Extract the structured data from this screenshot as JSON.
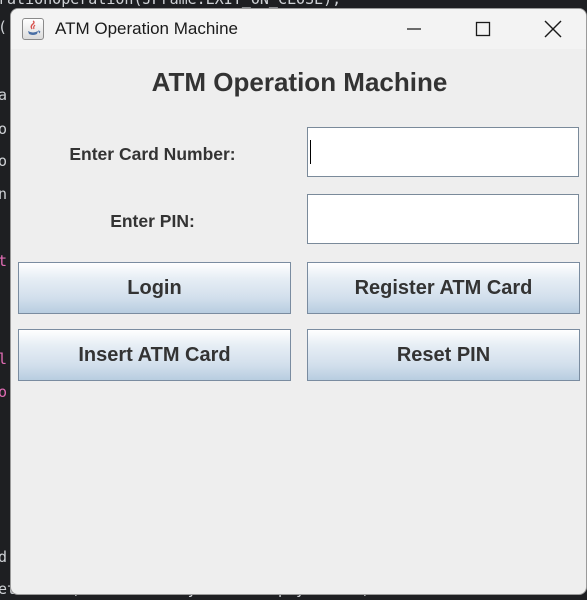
{
  "window": {
    "title": "ATM Operation Machine"
  },
  "form": {
    "heading": "ATM Operation Machine",
    "card_label": "Enter Card Number:",
    "card_value": "",
    "pin_label": "Enter PIN:",
    "pin_value": ""
  },
  "buttons": {
    "login": "Login",
    "register": "Register ATM Card",
    "insert": "Insert ATM Card",
    "reset": "Reset PIN"
  },
  "background_code": {
    "line1": "rationOperation(JFrame.EXIT_ON_CLOSE);",
    "line2": "(",
    "line3": "a",
    "line4": "o",
    "line5": "o",
    "line6": "n",
    "line7": "t",
    "line8": "l",
    "line9": "o",
    "line10": "d",
    "line11": "etBorder(BorderFactory.createEmptyBorder("
  }
}
